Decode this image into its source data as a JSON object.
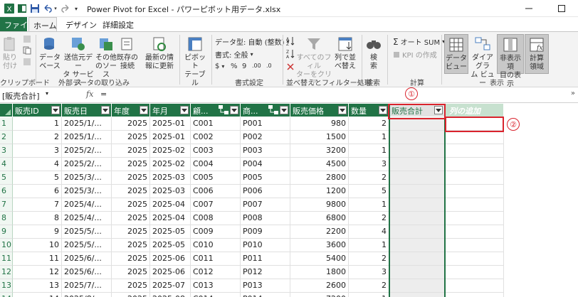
{
  "titlebar": {
    "title": "Power Pivot for Excel - パワーピボット用データ.xlsx",
    "undo_icon": "undo-icon",
    "redo_icon": "redo-icon",
    "minimize": "—",
    "maximize": "☐"
  },
  "ribbon_tabs": [
    "ファイル",
    "ホーム",
    "デザイン",
    "詳細設定"
  ],
  "ribbon": {
    "paste_label_1": "貼り",
    "paste_label_2": "付け",
    "datasource_1": "データ",
    "datasource_2": "ベース",
    "sendsvc_1": "送信元デー",
    "sendsvc_2": "タ サービス",
    "other_1": "その他",
    "other_2": "のソース",
    "existing_1": "既存の",
    "existing_2": "接続",
    "refresh_1": "最新の情",
    "refresh_2": "報に更新",
    "pivot_1": "ピボット",
    "pivot_2": "テーブル",
    "datatype": "データ型: 自動 (整数)",
    "format": "書式: 全般",
    "currency": "$",
    "percent": "%",
    "comma": "9",
    "dec_inc": ".00",
    "dec_dec": ".0",
    "clearfilter_1": "すべてのフィル",
    "clearfilter_2": "ターをクリア",
    "sortcol_1": "列で並",
    "sortcol_2": "べ替え",
    "find_1": "検",
    "find_2": "索",
    "autosum": "オート SUM",
    "kpi": "KPI の作成",
    "dataview_1": "データ",
    "dataview_2": "ビュー",
    "diagram_1": "ダイアグラ",
    "diagram_2": "ム ビュー",
    "hidden_1": "非表示項",
    "hidden_2": "目の表示",
    "calcarea_1": "計算",
    "calcarea_2": "領域",
    "groups": {
      "clipboard": "クリップボード",
      "external": "外部データの取り込み",
      "format": "書式設定",
      "sort": "並べ替えとフィルター処理",
      "find": "検索",
      "calc": "計算",
      "view": "表示"
    }
  },
  "formula_bar": {
    "name_box": "[販売合計]",
    "fx": "fx",
    "formula": "="
  },
  "columns": [
    {
      "label": "販売ID",
      "key": "id"
    },
    {
      "label": "販売日",
      "key": "date"
    },
    {
      "label": "年度",
      "key": "year"
    },
    {
      "label": "年月",
      "key": "ym"
    },
    {
      "label": "顧...",
      "key": "cust"
    },
    {
      "label": "商...",
      "key": "prod"
    },
    {
      "label": "販売価格",
      "key": "price"
    },
    {
      "label": "数量",
      "key": "qty"
    },
    {
      "label": "販売合計",
      "key": "total"
    },
    {
      "label": "列の追加",
      "key": "add"
    }
  ],
  "rows": [
    {
      "n": "1",
      "id": "1",
      "date": "2025/1/...",
      "year": "2025",
      "ym": "2025-01",
      "cust": "C001",
      "prod": "P001",
      "price": "980",
      "qty": "2"
    },
    {
      "n": "2",
      "id": "2",
      "date": "2025/1/...",
      "year": "2025",
      "ym": "2025-01",
      "cust": "C002",
      "prod": "P002",
      "price": "1500",
      "qty": "1"
    },
    {
      "n": "3",
      "id": "3",
      "date": "2025/2/...",
      "year": "2025",
      "ym": "2025-02",
      "cust": "C003",
      "prod": "P003",
      "price": "3200",
      "qty": "1"
    },
    {
      "n": "4",
      "id": "4",
      "date": "2025/2/...",
      "year": "2025",
      "ym": "2025-02",
      "cust": "C004",
      "prod": "P004",
      "price": "4500",
      "qty": "3"
    },
    {
      "n": "5",
      "id": "5",
      "date": "2025/3/...",
      "year": "2025",
      "ym": "2025-03",
      "cust": "C005",
      "prod": "P005",
      "price": "2800",
      "qty": "2"
    },
    {
      "n": "6",
      "id": "6",
      "date": "2025/3/...",
      "year": "2025",
      "ym": "2025-03",
      "cust": "C006",
      "prod": "P006",
      "price": "1200",
      "qty": "5"
    },
    {
      "n": "7",
      "id": "7",
      "date": "2025/4/...",
      "year": "2025",
      "ym": "2025-04",
      "cust": "C007",
      "prod": "P007",
      "price": "9800",
      "qty": "1"
    },
    {
      "n": "8",
      "id": "8",
      "date": "2025/4/...",
      "year": "2025",
      "ym": "2025-04",
      "cust": "C008",
      "prod": "P008",
      "price": "6800",
      "qty": "2"
    },
    {
      "n": "9",
      "id": "9",
      "date": "2025/5/...",
      "year": "2025",
      "ym": "2025-05",
      "cust": "C009",
      "prod": "P009",
      "price": "2200",
      "qty": "4"
    },
    {
      "n": "10",
      "id": "10",
      "date": "2025/5/...",
      "year": "2025",
      "ym": "2025-05",
      "cust": "C010",
      "prod": "P010",
      "price": "3600",
      "qty": "1"
    },
    {
      "n": "11",
      "id": "11",
      "date": "2025/6/...",
      "year": "2025",
      "ym": "2025-06",
      "cust": "C011",
      "prod": "P011",
      "price": "5400",
      "qty": "2"
    },
    {
      "n": "12",
      "id": "12",
      "date": "2025/6/...",
      "year": "2025",
      "ym": "2025-06",
      "cust": "C012",
      "prod": "P012",
      "price": "1800",
      "qty": "3"
    },
    {
      "n": "13",
      "id": "13",
      "date": "2025/7/...",
      "year": "2025",
      "ym": "2025-07",
      "cust": "C013",
      "prod": "P013",
      "price": "2600",
      "qty": "2"
    },
    {
      "n": "14",
      "id": "14",
      "date": "2025/8/...",
      "year": "2025",
      "ym": "2025-08",
      "cust": "C014",
      "prod": "P014",
      "price": "7200",
      "qty": "1"
    }
  ],
  "annotations": {
    "one": "①",
    "two": "②"
  },
  "colors": {
    "accent": "#217346",
    "annotation": "#d9232d"
  }
}
